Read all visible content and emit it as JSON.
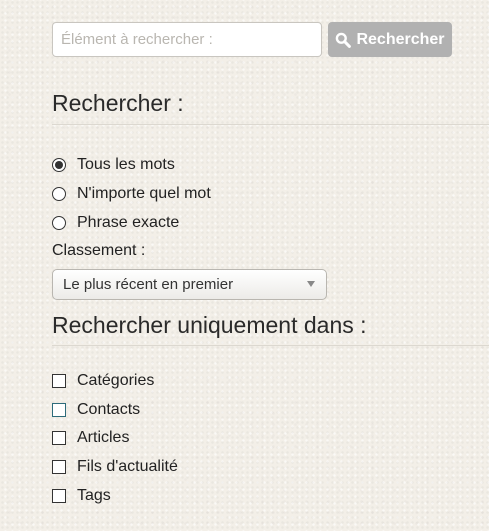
{
  "search": {
    "placeholder": "Élément à rechercher :",
    "value": "",
    "button_label": "Rechercher",
    "button_icon": "magnifier-icon"
  },
  "search_for": {
    "heading": "Rechercher :",
    "options": [
      {
        "label": "Tous les mots",
        "checked": true
      },
      {
        "label": "N'importe quel mot",
        "checked": false
      },
      {
        "label": "Phrase exacte",
        "checked": false
      }
    ]
  },
  "ordering": {
    "label": "Classement :",
    "selected": "Le plus récent en premier"
  },
  "areas": {
    "heading": "Rechercher uniquement dans :",
    "items": [
      {
        "label": "Catégories",
        "checked": false
      },
      {
        "label": "Contacts",
        "checked": false
      },
      {
        "label": "Articles",
        "checked": false
      },
      {
        "label": "Fils d'actualité",
        "checked": false
      },
      {
        "label": "Tags",
        "checked": false
      }
    ]
  },
  "colors": {
    "background": "#f3efe8",
    "button": "#b1b1b1",
    "focus_border": "#2d6b7a"
  }
}
